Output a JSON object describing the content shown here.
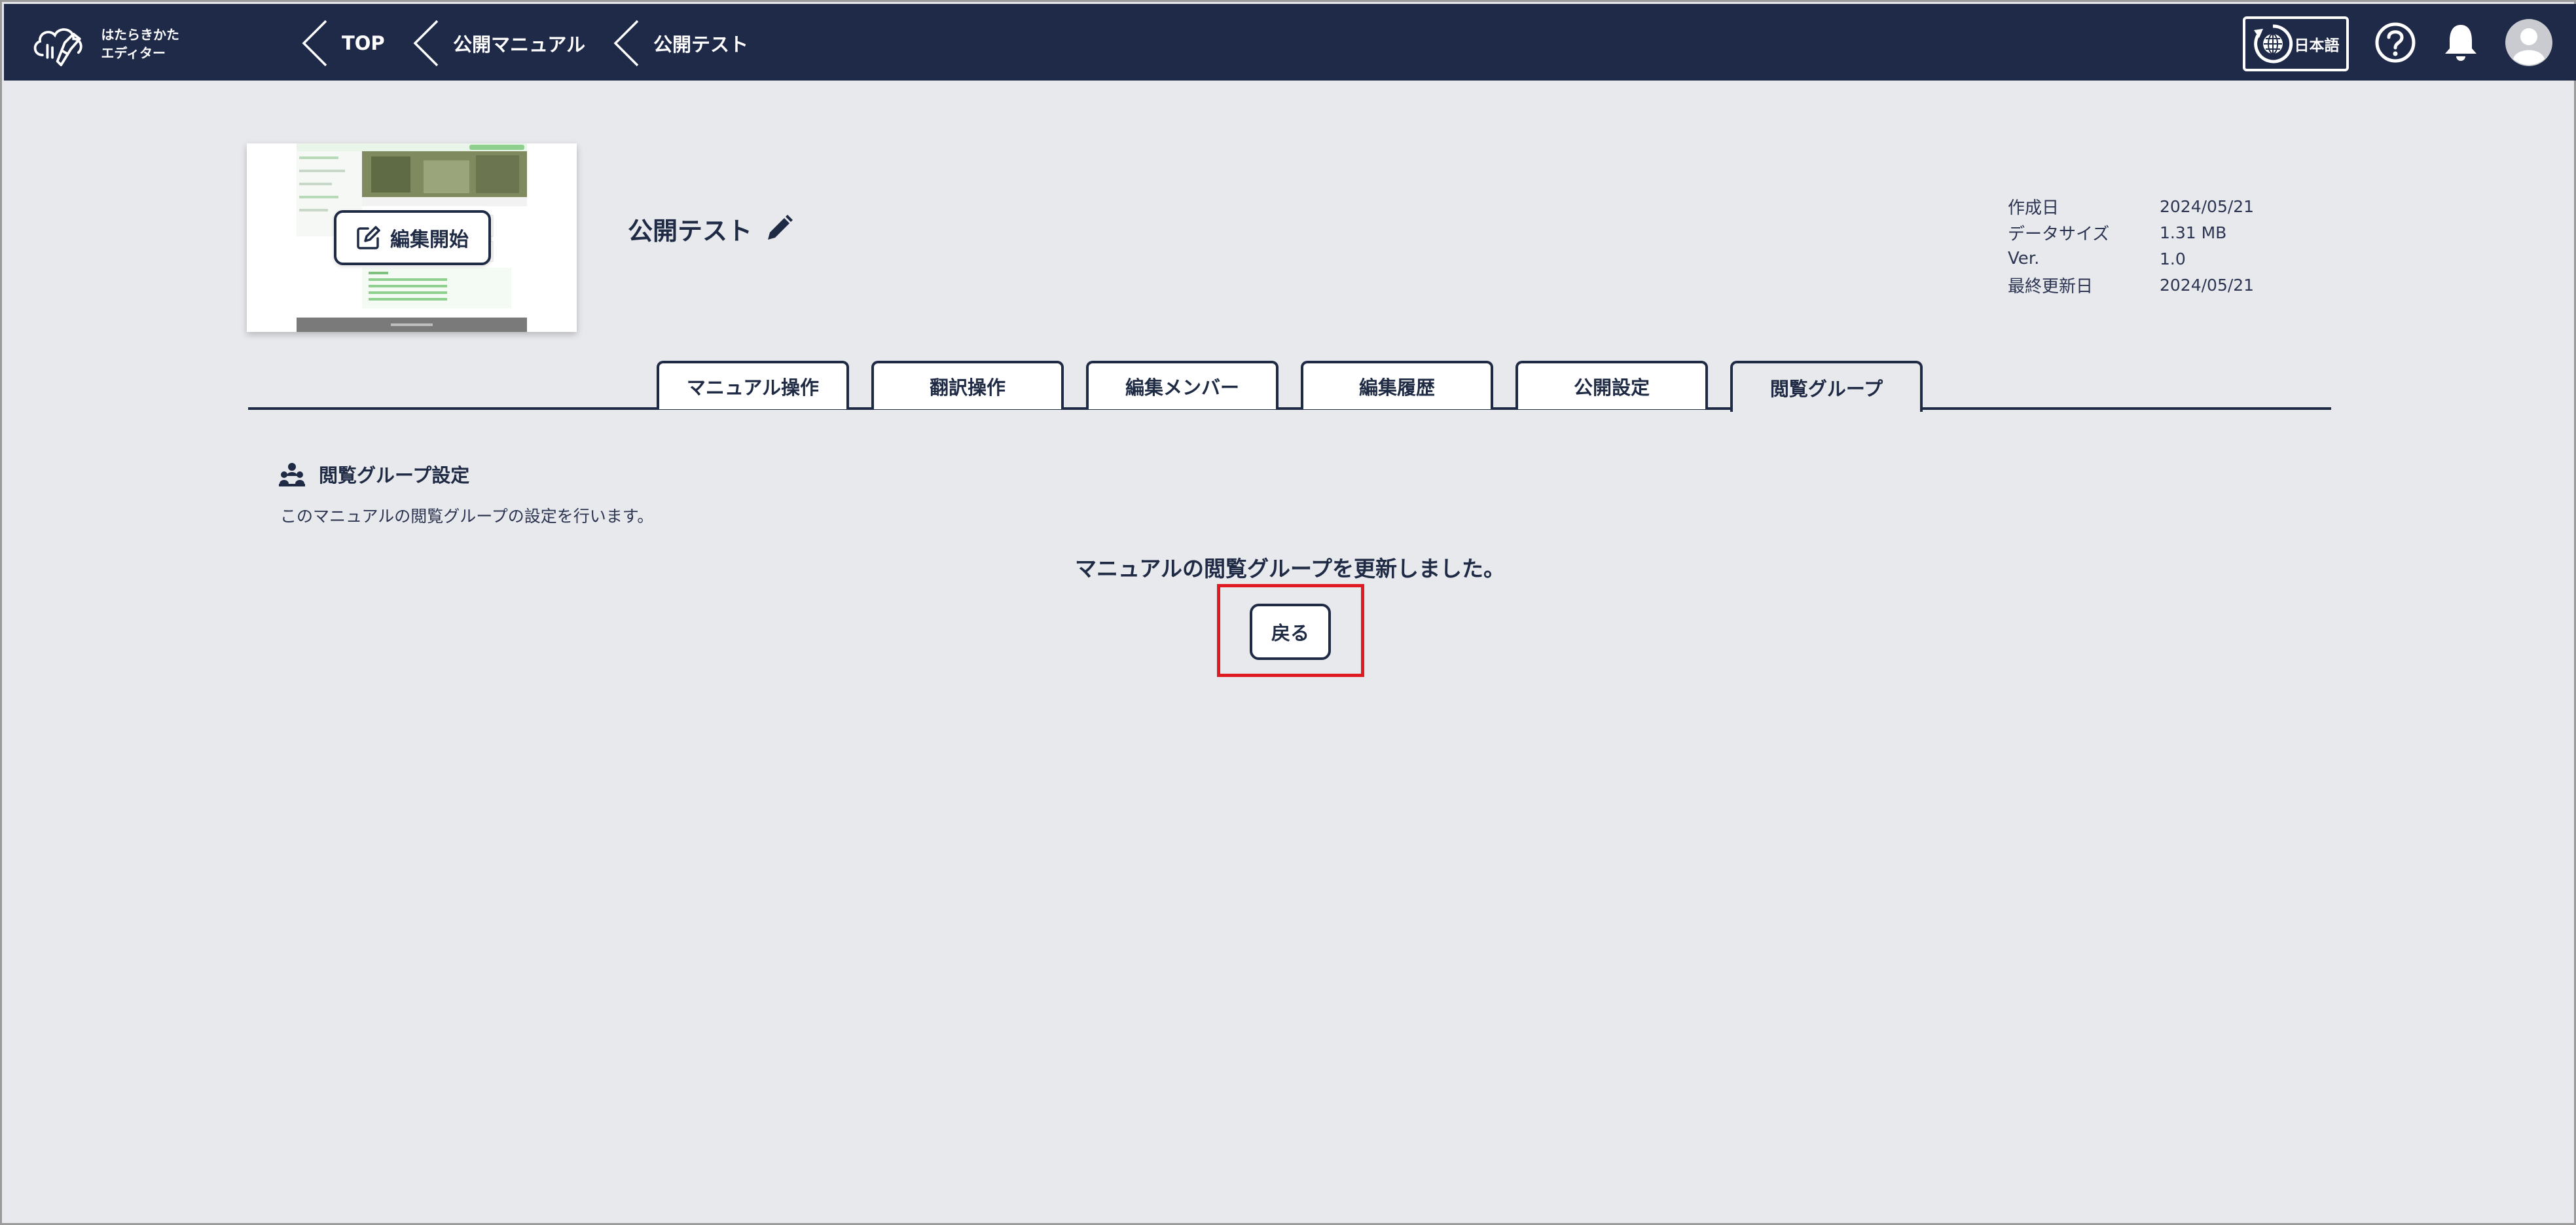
{
  "header": {
    "logo_line1": "はたらきかた",
    "logo_line2": "エディター",
    "breadcrumbs": [
      {
        "label": "TOP"
      },
      {
        "label": "公開マニュアル"
      },
      {
        "label": "公開テスト"
      }
    ],
    "language_label": "日本語",
    "icons": {
      "language": "globe-refresh-icon",
      "help": "help-circle-icon",
      "notifications": "bell-icon",
      "user": "user-avatar-icon"
    }
  },
  "manual": {
    "edit_start_label": "編集開始",
    "title": "公開テスト",
    "meta": [
      {
        "key": "作成日",
        "value": "2024/05/21"
      },
      {
        "key": "データサイズ",
        "value": "1.31 MB"
      },
      {
        "key": "Ver.",
        "value": "1.0"
      },
      {
        "key": "最終更新日",
        "value": "2024/05/21"
      }
    ]
  },
  "tabs": [
    {
      "label": "マニュアル操作",
      "active": false
    },
    {
      "label": "翻訳操作",
      "active": false
    },
    {
      "label": "編集メンバー",
      "active": false
    },
    {
      "label": "編集履歴",
      "active": false
    },
    {
      "label": "公開設定",
      "active": false
    },
    {
      "label": "閲覧グループ",
      "active": true
    }
  ],
  "content": {
    "section_title": "閲覧グループ設定",
    "section_description": "このマニュアルの閲覧グループの設定を行います。",
    "result_message": "マニュアルの閲覧グループを更新しました。",
    "back_label": "戻る"
  },
  "colors": {
    "header_bg": "#1f2a48",
    "page_bg": "#e8e9ed",
    "accent_navy": "#1f2a44",
    "highlight_red": "#e01a22"
  }
}
